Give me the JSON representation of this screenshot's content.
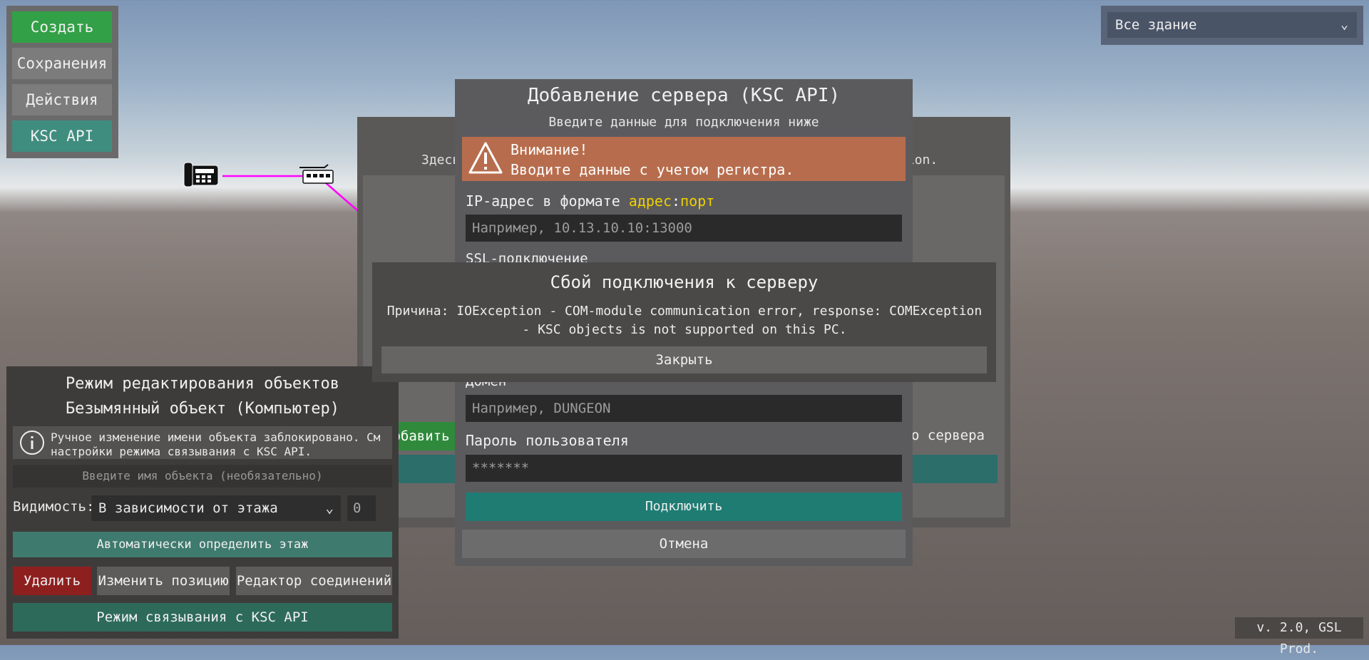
{
  "menu": {
    "create_label": "Создать",
    "saves_label": "Сохранения",
    "actions_label": "Действия",
    "ksc_label": "KSC API"
  },
  "floor_select": {
    "value": "Все здание"
  },
  "ksc_panel": {
    "hint_left": "Здесь",
    "hint_right": "tion.",
    "add_label": "Добавить с",
    "right_text": "го сервера"
  },
  "add_server": {
    "title": "Добавление сервера (KSC API)",
    "subtitle": "Введите данные для подключения ниже",
    "warning_title": "Внимание!",
    "warning_text": "Вводите данные с учетом регистра.",
    "ip_label_prefix": "IP-адрес в формате ",
    "ip_label_addr": "адрес",
    "ip_label_sep": ":",
    "ip_label_port": "порт",
    "ip_placeholder": "Например, 10.13.10.10:13000",
    "ssl_label": "SSL-подключение",
    "domain_label": "Домен",
    "domain_placeholder": "Например, DUNGEON",
    "password_label": "Пароль пользователя",
    "password_value": "*******",
    "connect_label": "Подключить",
    "cancel_label": "Отмена",
    "accent_color": "#f0d000"
  },
  "error_dialog": {
    "title": "Сбой подключения к серверу",
    "reason": "Причина: IOException - COM-module communication error, response: COMException - KSC objects is not supported on this PC.",
    "close_label": "Закрыть"
  },
  "editor": {
    "title": "Режим редактирования объектов",
    "object_name": "Безымянный объект (Компьютер)",
    "info_text": "Ручное изменение имени объекта заблокировано. См\nнастройки режима связывания с KSC API.",
    "name_placeholder": "Введите имя объекта (необязательно)",
    "visibility_label": "Видимость:",
    "visibility_value": "В зависимости от этажа",
    "visibility_num": "0",
    "auto_floor_label": "Автоматически определить этаж",
    "delete_label": "Удалить",
    "move_label": "Изменить позицию",
    "connections_label": "Редактор соединений",
    "ksc_mode_label": "Режим связывания с KSC API"
  },
  "version": "v. 2.0, GSL Prod."
}
